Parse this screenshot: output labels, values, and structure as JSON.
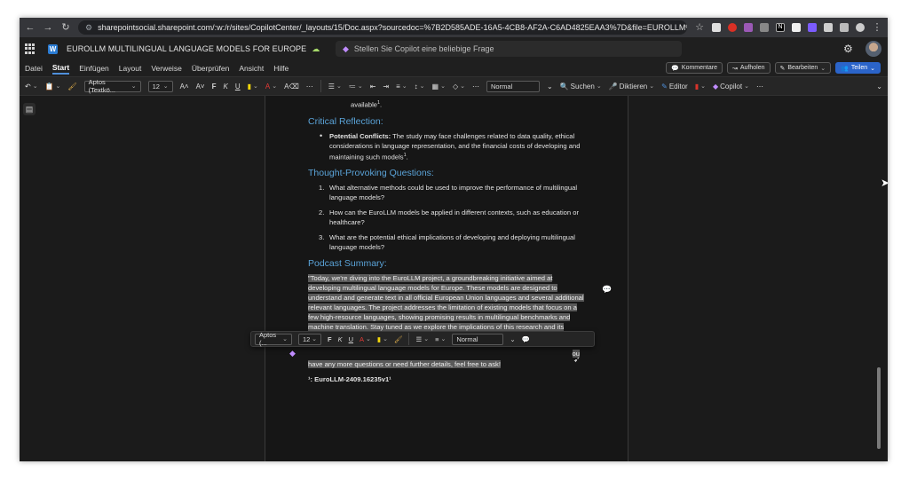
{
  "browser": {
    "url": "sharepointsocial.sharepoint.com/:w:/r/sites/CopilotCenter/_layouts/15/Doc.aspx?sourcedoc=%7B2D585ADE-16A5-4CB8-AF2A-C6AD4825EAA3%7D&file=EUROLLM%20MULTILINGUAL%..."
  },
  "titlebar": {
    "doc_title": "EUROLLM MULTILINGUAL LANGUAGE MODELS FOR EUROPE",
    "search_placeholder": "Stellen Sie Copilot eine beliebige Frage"
  },
  "menu": {
    "items": [
      "Datei",
      "Start",
      "Einfügen",
      "Layout",
      "Verweise",
      "Überprüfen",
      "Ansicht",
      "Hilfe"
    ],
    "active": "Start",
    "comments": "Kommentare",
    "catchup": "Aufholen",
    "editing": "Bearbeiten",
    "share": "Teilen"
  },
  "ribbon": {
    "font": "Aptos (Textkö...",
    "size": "12",
    "bold": "F",
    "italic": "K",
    "underline": "U",
    "style": "Normal",
    "find": "Suchen",
    "dictate": "Diktieren",
    "editor": "Editor",
    "copilot": "Copilot"
  },
  "document": {
    "top_fragment": "available",
    "top_fragment_ref": "1",
    "section1_title": "Critical Reflection:",
    "bullet1_label": "Potential Conflicts:",
    "bullet1_text": " The study may face challenges related to data quality, ethical considerations in language representation, and the financial costs of developing and maintaining such models",
    "bullet1_ref": "1",
    "section2_title": "Thought-Provoking Questions:",
    "questions": [
      "What alternative methods could be used to improve the performance of multilingual language models?",
      "How can the EuroLLM models be applied in different contexts, such as education or healthcare?",
      "What are the potential ethical implications of developing and deploying multilingual language models?"
    ],
    "section3_title": "Podcast Summary:",
    "podcast_text": "\"Today, we're diving into the EuroLLM project, a groundbreaking initiative aimed at developing multilingual language models for Europe. These models are designed to understand and generate text in all official European Union languages and several additional relevant languages. The project addresses the limitation of existing models that focus on a few high-resource languages, showing promising results in multilingual benchmarks and machine translation. Stay tuned as we explore the implications of this research and its potential impact on communication and accessibility across Europe.\"",
    "podcast_tail_fragment": "ou",
    "closing_line": "have any more questions or need further details, feel free to ask!",
    "footnote": "¹: EuroLLM-2409.16235v1¹"
  },
  "minitoolbar": {
    "font": "Aptos (...",
    "size": "12",
    "bold": "F",
    "italic": "K",
    "underline": "U",
    "style": "Normal"
  },
  "colors": {
    "heading": "#5aa3d8",
    "accent": "#2b64c9",
    "selection": "#5a5a5a"
  }
}
